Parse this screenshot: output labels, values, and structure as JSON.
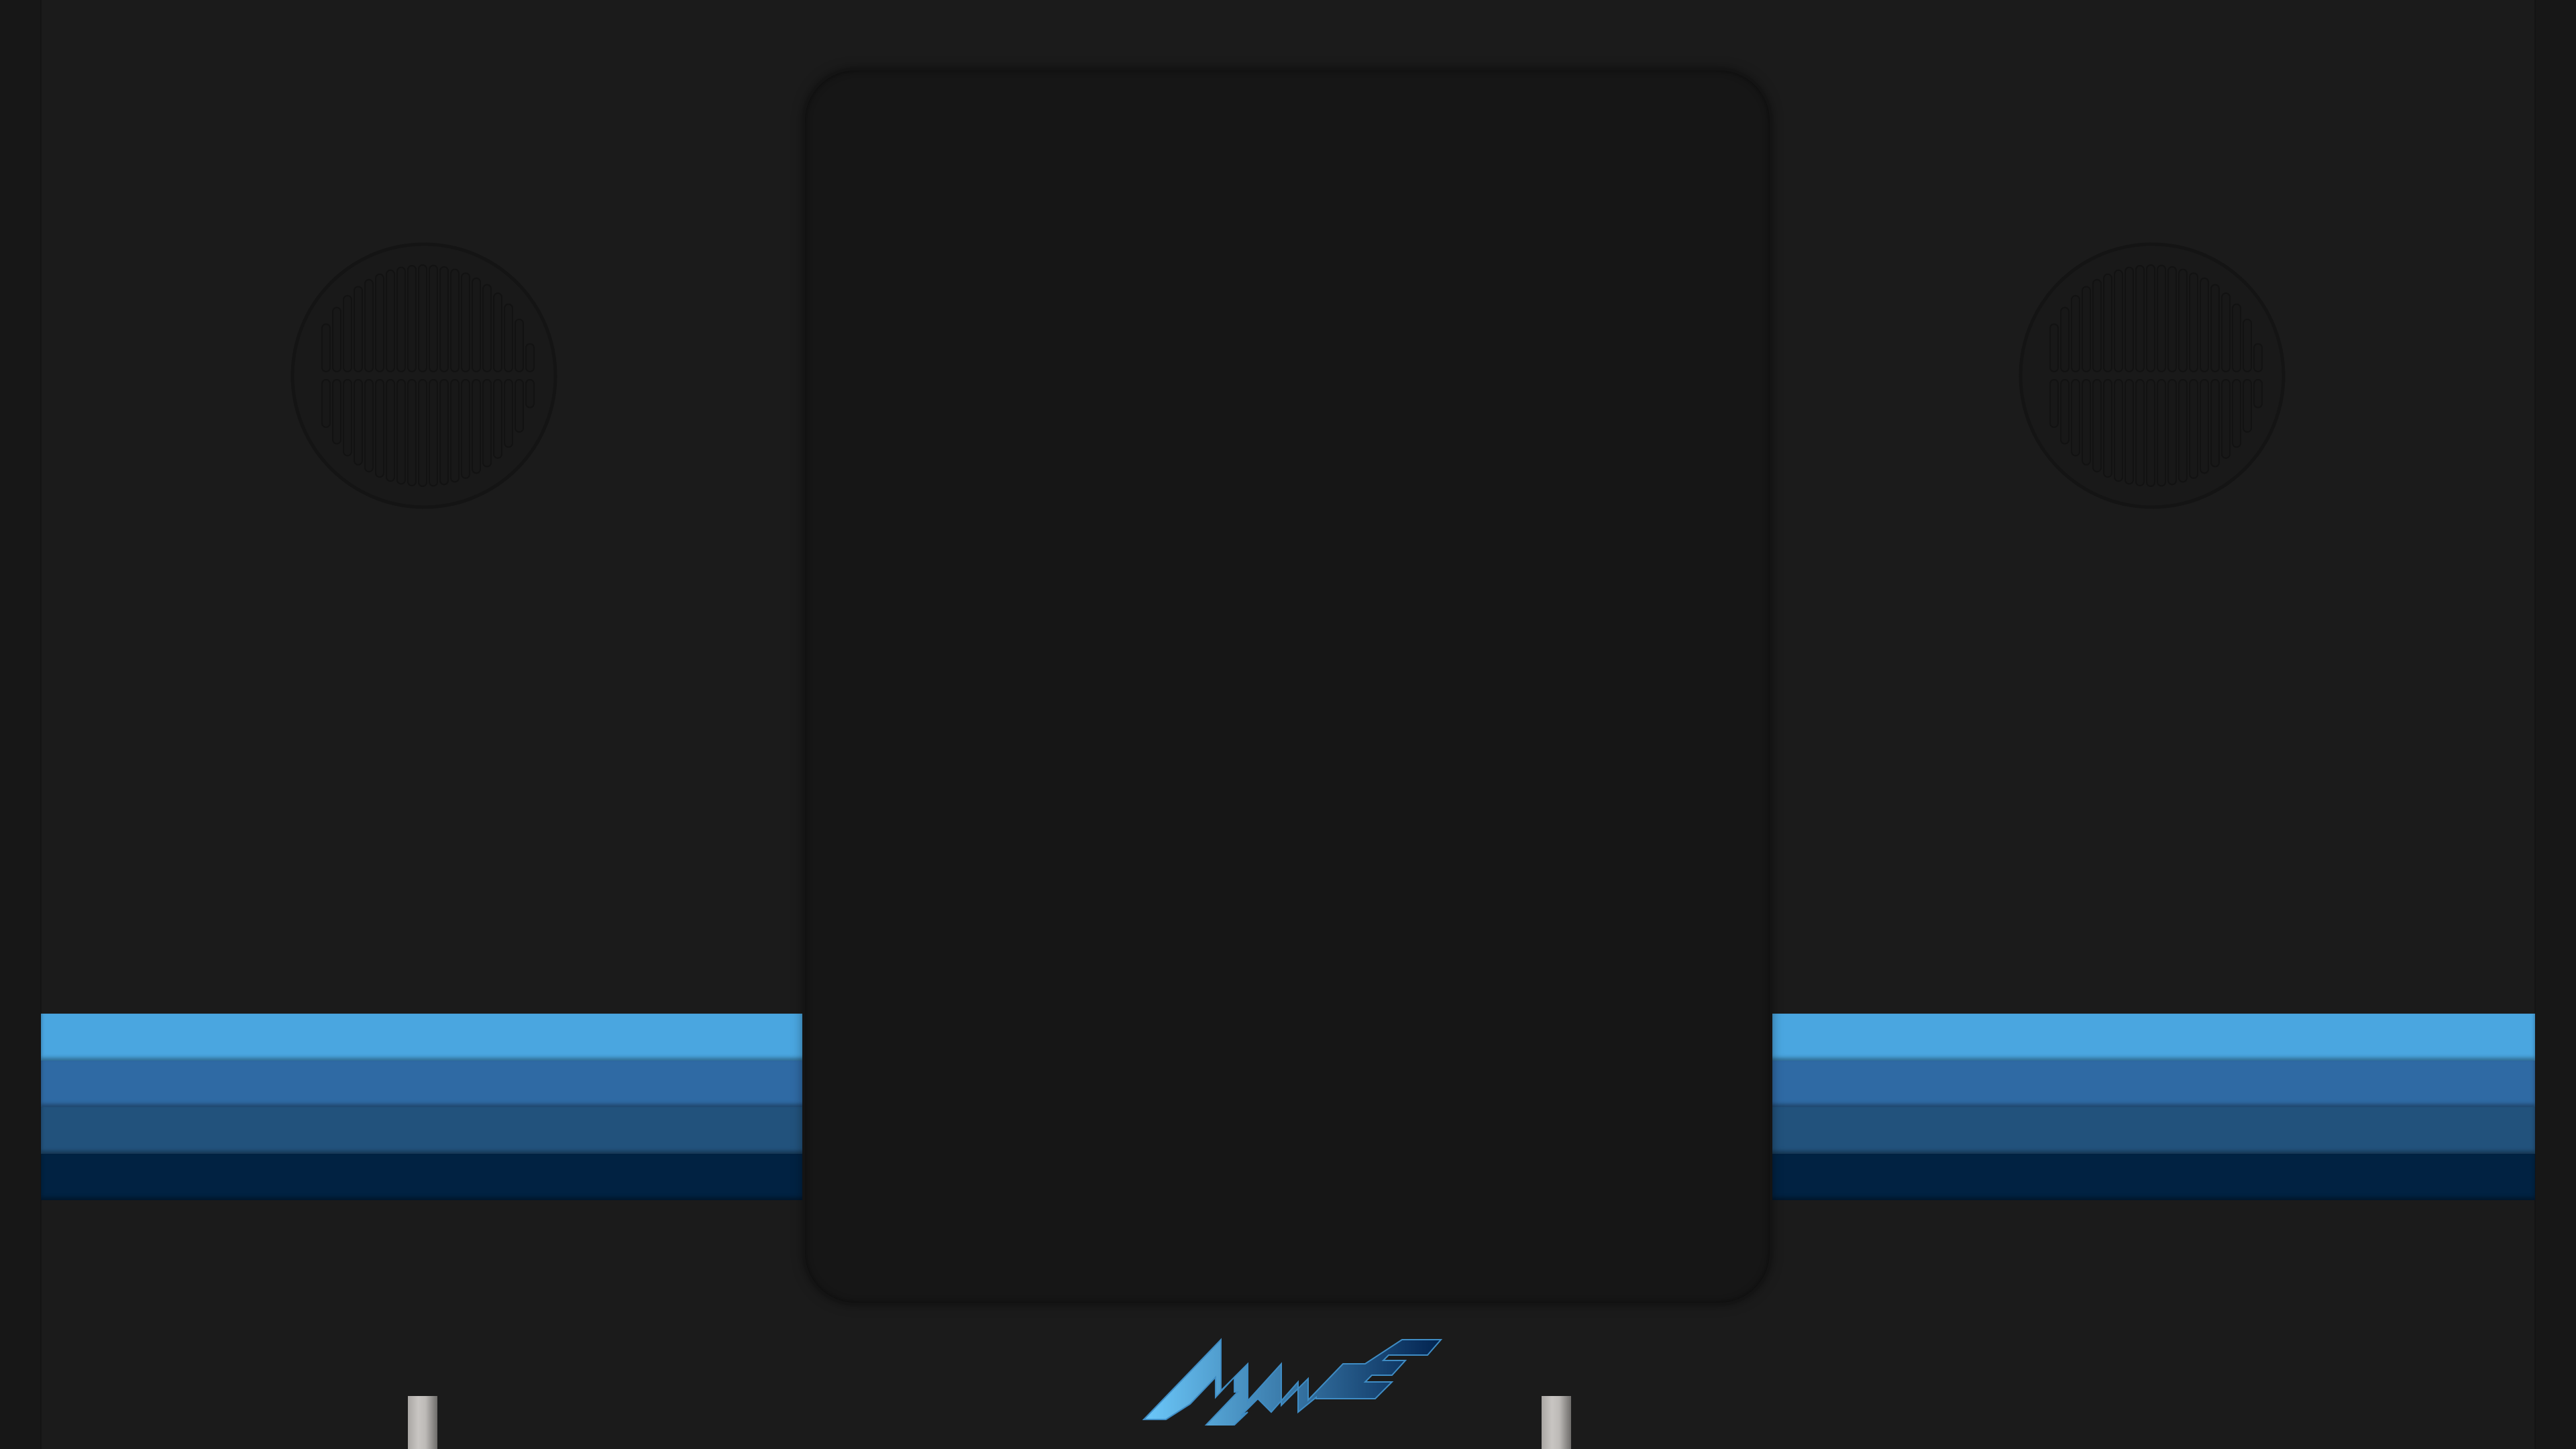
{
  "cabinet": {
    "logo_text": "MAME",
    "colors": {
      "body": "#1b1b1b",
      "screen": "#161616",
      "stripes": [
        "#4aa6e0",
        "#2f6aa4",
        "#22527c",
        "#012242"
      ],
      "logo_gradient": [
        "#6cc8fa",
        "#022350"
      ]
    },
    "speakers": [
      "speaker-grille-icon",
      "speaker-grille-icon"
    ],
    "controls": [
      "joystick-icon",
      "joystick-icon"
    ]
  }
}
